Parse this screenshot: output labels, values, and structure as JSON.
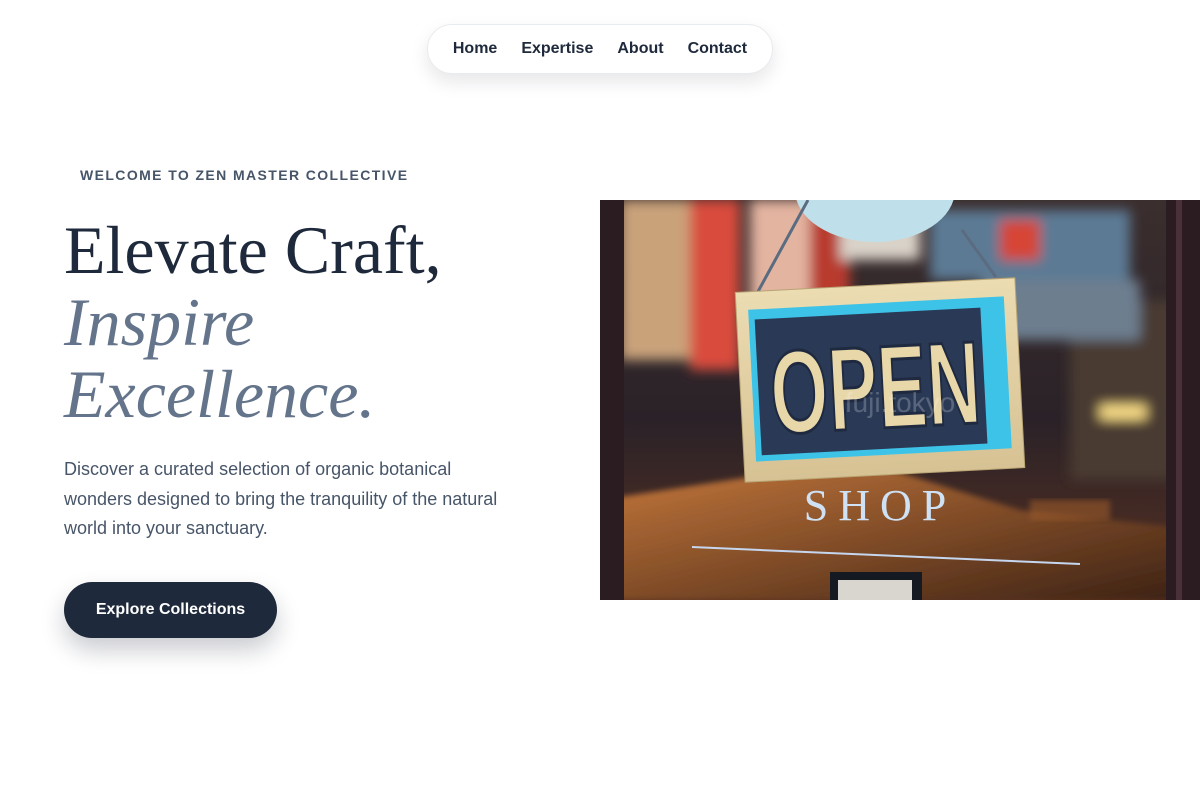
{
  "nav": {
    "items": [
      {
        "label": "Home"
      },
      {
        "label": "Expertise"
      },
      {
        "label": "About"
      },
      {
        "label": "Contact"
      }
    ]
  },
  "hero": {
    "kicker": "WELCOME TO ZEN MASTER COLLECTIVE",
    "headline_line1": "Elevate Craft,",
    "headline_line2": "Inspire",
    "headline_line3": "Excellence.",
    "description": "Discover a curated selection of organic botanical wonders designed to bring the tranquility of the natural world into your sanctuary.",
    "cta_label": "Explore Collections"
  },
  "image": {
    "sign_text": "OPEN",
    "window_text": "SHOP",
    "watermark": "fuji.tokyo"
  },
  "colors": {
    "primary": "#1e293b",
    "muted": "#64748b",
    "sign_blue": "#3ec3e8",
    "sign_card": "#e5d4a8"
  }
}
